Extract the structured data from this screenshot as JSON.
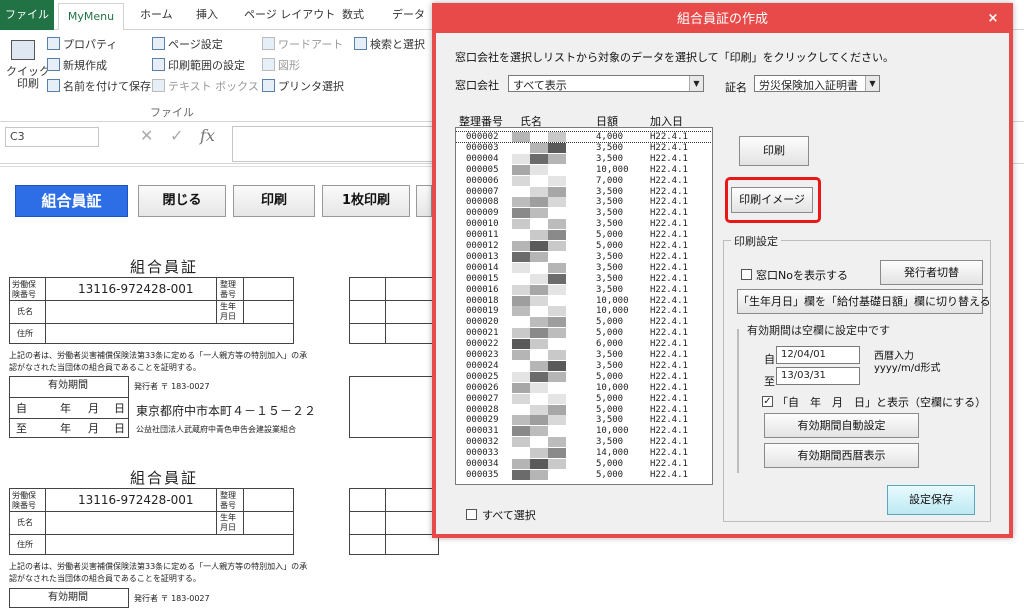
{
  "ribbon": {
    "tabs": {
      "file": "ファイル",
      "mymenu": "MyMenu",
      "home": "ホーム",
      "insert": "挿入",
      "page_layout": "ページ レイアウト",
      "formulas": "数式",
      "data": "データ"
    },
    "quick_print": "クイック\n印刷",
    "items": {
      "property": "プロパティ",
      "new": "新規作成",
      "save_as": "名前を付けて保存",
      "page_setup": "ページ設定",
      "print_area": "印刷範囲の設定",
      "text_box": "テキスト ボックス",
      "wordart": "ワードアート",
      "shapes": "図形",
      "printer_select": "プリンタ選択",
      "search_select": "検索と選択"
    },
    "group_file": "ファイル"
  },
  "formula_bar": {
    "cell": "C3",
    "fx": "fx"
  },
  "sheet": {
    "buttons": {
      "card": "組合員証",
      "close": "閉じる",
      "print": "印刷",
      "print_one": "1枚印刷"
    },
    "cards": [
      {
        "title": "組合員証",
        "labels": {
          "labor_no": "労働保\n険番号",
          "name": "氏名",
          "address": "住所",
          "seiri": "整理\n番号",
          "birth": "生年\n月日"
        },
        "insurance_no": "13116-972428-001",
        "notice": "上記の者は、労働者災害補償保険法第33条に定める「一人親方等の特別加入」の承\n認がなされた当団体の組合員であることを証明する。",
        "validity": "有効期間",
        "issuer": "発行者 〒 183-0027",
        "from": "自",
        "to": "至",
        "y": "年",
        "m": "月",
        "d": "日",
        "issuer_address": "東京都府中市本町４－１５－２２",
        "issuer_org": "公益社団法人武蔵府中青色申告会建設業組合"
      },
      {
        "title": "組合員証",
        "insurance_no": "13116-972428-001",
        "validity": "有効期間",
        "issuer": "発行者 〒 183-0027"
      }
    ]
  },
  "dialog": {
    "title": "組合員証の作成",
    "close": "×",
    "instruction": "窓口会社を選択しリストから対象のデータを選択して「印刷」をクリックしてください。",
    "window_company_label": "窓口会社",
    "window_company_value": "すべて表示",
    "cert_label": "証名",
    "cert_value": "労災保険加入証明書",
    "columns": {
      "no": "整理番号",
      "name": "氏名",
      "daily": "日額",
      "joined": "加入日"
    },
    "rows": [
      [
        "000002",
        "4,000",
        "H22.4.1"
      ],
      [
        "000003",
        "3,500",
        "H22.4.1"
      ],
      [
        "000004",
        "3,500",
        "H22.4.1"
      ],
      [
        "000005",
        "10,000",
        "H22.4.1"
      ],
      [
        "000006",
        "7,000",
        "H22.4.1"
      ],
      [
        "000007",
        "3,500",
        "H22.4.1"
      ],
      [
        "000008",
        "3,500",
        "H22.4.1"
      ],
      [
        "000009",
        "3,500",
        "H22.4.1"
      ],
      [
        "000010",
        "3,500",
        "H22.4.1"
      ],
      [
        "000011",
        "5,000",
        "H22.4.1"
      ],
      [
        "000012",
        "5,000",
        "H22.4.1"
      ],
      [
        "000013",
        "3,500",
        "H22.4.1"
      ],
      [
        "000014",
        "3,500",
        "H22.4.1"
      ],
      [
        "000015",
        "3,500",
        "H22.4.1"
      ],
      [
        "000016",
        "3,500",
        "H22.4.1"
      ],
      [
        "000018",
        "10,000",
        "H22.4.1"
      ],
      [
        "000019",
        "10,000",
        "H22.4.1"
      ],
      [
        "000020",
        "5,000",
        "H22.4.1"
      ],
      [
        "000021",
        "5,000",
        "H22.4.1"
      ],
      [
        "000022",
        "6,000",
        "H22.4.1"
      ],
      [
        "000023",
        "3,500",
        "H22.4.1"
      ],
      [
        "000024",
        "3,500",
        "H22.4.1"
      ],
      [
        "000025",
        "5,000",
        "H22.4.1"
      ],
      [
        "000026",
        "10,000",
        "H22.4.1"
      ],
      [
        "000027",
        "5,000",
        "H22.4.1"
      ],
      [
        "000028",
        "5,000",
        "H22.4.1"
      ],
      [
        "000029",
        "3,500",
        "H22.4.1"
      ],
      [
        "000031",
        "10,000",
        "H22.4.1"
      ],
      [
        "000032",
        "3,500",
        "H22.4.1"
      ],
      [
        "000033",
        "14,000",
        "H22.4.1"
      ],
      [
        "000034",
        "5,000",
        "H22.4.1"
      ],
      [
        "000035",
        "5,000",
        "H22.4.1"
      ]
    ],
    "select_all": "すべて選択",
    "print_button": "印刷",
    "print_image_button": "印刷イメージ",
    "print_settings": "印刷設定",
    "show_window_no": "窓口Noを表示する",
    "switch_issuer": "発行者切替",
    "switch_birth": "「生年月日」欄を「給付基礎日額」欄に切り替える",
    "validity_group": "有効期間は空欄に設定中です",
    "from_label": "自",
    "to_label": "至",
    "from_value": "12/04/01",
    "to_value": "13/03/31",
    "format_hint": "西暦入力\nyyyy/m/d形式",
    "show_ymd": "「自　年　月　日」と表示（空欄にする）",
    "auto_validity": "有効期間自動設定",
    "western_validity": "有効期間西暦表示",
    "save_settings": "設定保存"
  }
}
